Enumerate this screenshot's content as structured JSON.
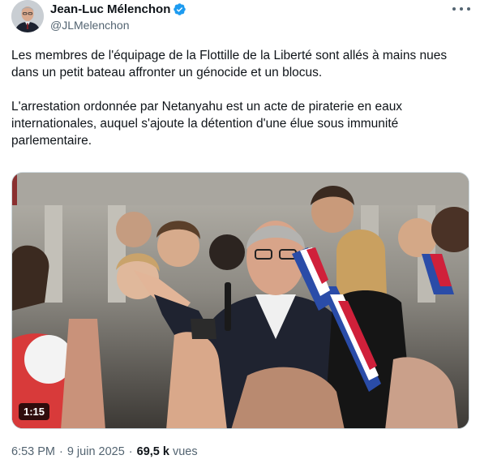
{
  "author": {
    "display_name": "Jean-Luc Mélenchon",
    "handle": "@JLMelenchon",
    "verified": true,
    "avatar_icon": "profile-avatar",
    "verified_icon": "verified-badge-icon"
  },
  "more_menu": {
    "icon": "more-horizontal-icon"
  },
  "tweet": {
    "paragraphs": [
      "Les membres de l'équipage de la Flottille de la Liberté sont allés à mains nues dans un petit bateau affronter un génocide et un blocus.",
      "L'arrestation ordonnée par Netanyahu est un acte de piraterie en eaux internationales, auquel s'ajoute la détention d'une élue sous immunité parlementaire."
    ]
  },
  "media": {
    "type": "video",
    "duration": "1:15"
  },
  "meta": {
    "time": "6:53 PM",
    "date": "9 juin 2025",
    "views_count": "69,5 k",
    "views_label": "vues",
    "separator": "·"
  },
  "colors": {
    "text_primary": "#0f1419",
    "text_secondary": "#536471",
    "verified_blue": "#1d9bf0"
  }
}
